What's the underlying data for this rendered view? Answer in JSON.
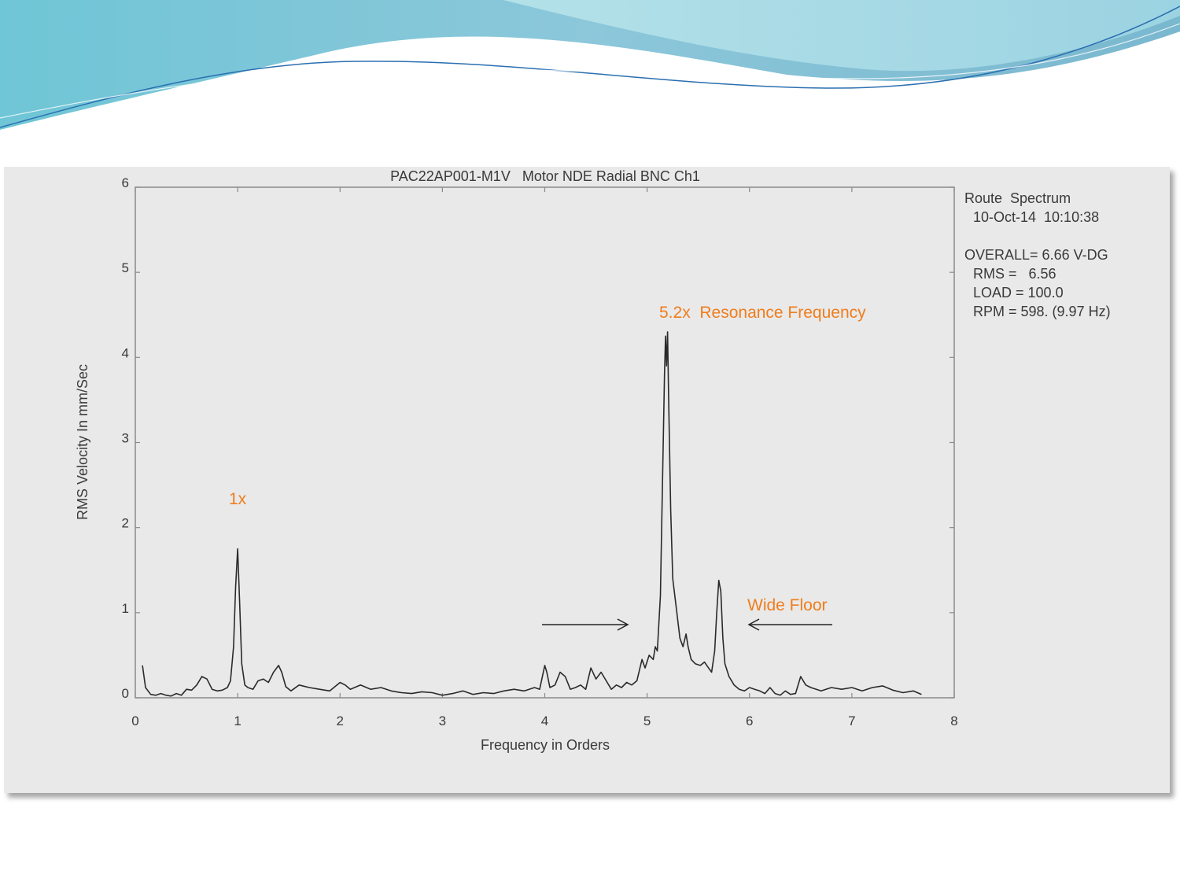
{
  "chart_data": {
    "type": "line",
    "title": "PAC22AP001-M1V   Motor NDE Radial BNC Ch1",
    "xlabel": "Frequency in Orders",
    "ylabel": "RMS Velocity In mm/Sec",
    "xlim": [
      0,
      8
    ],
    "ylim": [
      0,
      6
    ],
    "xticks": [
      "0",
      "1",
      "2",
      "3",
      "4",
      "5",
      "6",
      "7",
      "8"
    ],
    "yticks": [
      "0",
      "1",
      "2",
      "3",
      "4",
      "5",
      "6"
    ],
    "series": [
      {
        "values_x": [
          0.07,
          0.1,
          0.15,
          0.2,
          0.25,
          0.3,
          0.35,
          0.4,
          0.45,
          0.5,
          0.55,
          0.6,
          0.65,
          0.7,
          0.75,
          0.8,
          0.85,
          0.9,
          0.93,
          0.96,
          0.98,
          1.0,
          1.02,
          1.04,
          1.07,
          1.1,
          1.15,
          1.2,
          1.25,
          1.3,
          1.35,
          1.4,
          1.43,
          1.47,
          1.52,
          1.6,
          1.7,
          1.8,
          1.9,
          2.0,
          2.05,
          2.1,
          2.2,
          2.3,
          2.4,
          2.5,
          2.6,
          2.7,
          2.8,
          2.9,
          3.0,
          3.1,
          3.2,
          3.3,
          3.4,
          3.5,
          3.6,
          3.7,
          3.8,
          3.9,
          3.95,
          4.0,
          4.02,
          4.05,
          4.1,
          4.15,
          4.2,
          4.25,
          4.3,
          4.35,
          4.4,
          4.45,
          4.5,
          4.55,
          4.6,
          4.65,
          4.7,
          4.75,
          4.8,
          4.85,
          4.9,
          4.95,
          4.98,
          5.02,
          5.06,
          5.08,
          5.1,
          5.13,
          5.15,
          5.17,
          5.18,
          5.19,
          5.2,
          5.21,
          5.23,
          5.25,
          5.28,
          5.32,
          5.35,
          5.38,
          5.4,
          5.43,
          5.47,
          5.52,
          5.56,
          5.6,
          5.63,
          5.66,
          5.68,
          5.7,
          5.72,
          5.74,
          5.76,
          5.8,
          5.85,
          5.9,
          5.95,
          6.0,
          6.05,
          6.1,
          6.15,
          6.2,
          6.25,
          6.3,
          6.35,
          6.4,
          6.45,
          6.5,
          6.55,
          6.6,
          6.7,
          6.8,
          6.9,
          7.0,
          7.1,
          7.2,
          7.3,
          7.4,
          7.5,
          7.6,
          7.68
        ],
        "values_y": [
          0.38,
          0.12,
          0.04,
          0.03,
          0.05,
          0.03,
          0.02,
          0.05,
          0.03,
          0.1,
          0.09,
          0.15,
          0.25,
          0.22,
          0.1,
          0.08,
          0.09,
          0.12,
          0.2,
          0.6,
          1.3,
          1.75,
          1.1,
          0.4,
          0.15,
          0.12,
          0.1,
          0.2,
          0.22,
          0.18,
          0.3,
          0.38,
          0.3,
          0.13,
          0.08,
          0.15,
          0.12,
          0.1,
          0.08,
          0.18,
          0.15,
          0.1,
          0.15,
          0.1,
          0.12,
          0.08,
          0.06,
          0.05,
          0.07,
          0.06,
          0.03,
          0.05,
          0.08,
          0.04,
          0.06,
          0.05,
          0.08,
          0.1,
          0.08,
          0.12,
          0.1,
          0.38,
          0.3,
          0.12,
          0.15,
          0.3,
          0.25,
          0.1,
          0.12,
          0.15,
          0.1,
          0.35,
          0.22,
          0.3,
          0.2,
          0.1,
          0.15,
          0.12,
          0.18,
          0.15,
          0.2,
          0.45,
          0.35,
          0.5,
          0.45,
          0.6,
          0.55,
          1.2,
          2.5,
          3.8,
          4.25,
          3.9,
          4.3,
          3.5,
          2.2,
          1.4,
          1.1,
          0.7,
          0.6,
          0.75,
          0.6,
          0.45,
          0.4,
          0.38,
          0.42,
          0.35,
          0.3,
          0.55,
          1.0,
          1.38,
          1.25,
          0.7,
          0.4,
          0.25,
          0.15,
          0.1,
          0.08,
          0.12,
          0.1,
          0.08,
          0.05,
          0.12,
          0.05,
          0.03,
          0.08,
          0.04,
          0.05,
          0.25,
          0.15,
          0.12,
          0.08,
          0.12,
          0.1,
          0.12,
          0.08,
          0.12,
          0.14,
          0.09,
          0.06,
          0.08,
          0.04
        ]
      }
    ],
    "annotations": [
      {
        "text": "1x",
        "x": 1.0,
        "y": 2.3
      },
      {
        "text": "5.2x  Resonance Frequency",
        "x": 5.2,
        "y": 4.4
      },
      {
        "text": "Wide Floor",
        "x": 6.4,
        "y": 1.05
      }
    ],
    "info_box": {
      "line1": "Route  Spectrum",
      "line2": "10-Oct-14  10:10:38",
      "line3": "OVERALL= 6.66 V-DG",
      "line4": "RMS =   6.56",
      "line5": "LOAD = 100.0",
      "line6": "RPM = 598. (9.97 Hz)"
    },
    "colors": {
      "line": "#2a2a2a",
      "annotation": "#f07d1c",
      "panel": "#e9e9e9",
      "text": "#3a3a3a"
    }
  }
}
